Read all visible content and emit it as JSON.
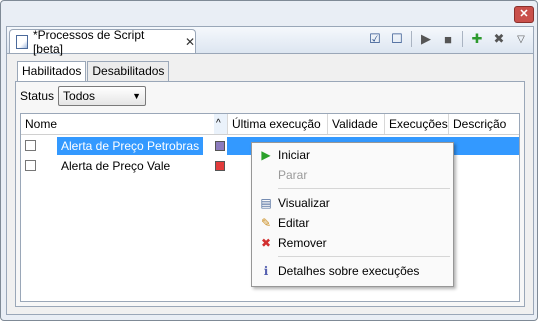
{
  "window": {
    "close_glyph": "✕"
  },
  "editor_tab": {
    "title": "*Processos de Script [beta]",
    "close_glyph": "✕"
  },
  "toolbar": {
    "icons": [
      "checkbox-checked-icon",
      "checkbox-empty-icon",
      "play-icon",
      "stop-icon",
      "add-icon",
      "remove-icon",
      "dropdown-arrow-icon"
    ],
    "glyphs": {
      "check": "☑",
      "uncheck": "☐",
      "play": "▶",
      "stop": "■",
      "add": "✚",
      "remove": "✖",
      "menu": "▽"
    }
  },
  "subtabs": [
    "Habilitados",
    "Desabilitados"
  ],
  "status": {
    "label": "Status",
    "value": "Todos",
    "arrow": "▼"
  },
  "table": {
    "sort_glyph": "^",
    "columns": [
      "Nome",
      "Última execução",
      "Validade",
      "Execuções",
      "Descrição"
    ],
    "rows": [
      {
        "name": "Alerta de Preço Petrobras",
        "color": "#8c7bbd"
      },
      {
        "name": "Alerta de Preço Vale",
        "color": "#e23b3b"
      }
    ]
  },
  "context_menu": {
    "items": [
      {
        "label": "Iniciar",
        "icon": "play-icon",
        "glyph": "▶",
        "enabled": true
      },
      {
        "label": "Parar",
        "icon": "",
        "enabled": false
      },
      {
        "label": "Visualizar",
        "icon": "document-icon",
        "glyph": "▤",
        "enabled": true
      },
      {
        "label": "Editar",
        "icon": "edit-icon",
        "glyph": "✎",
        "enabled": true
      },
      {
        "label": "Remover",
        "icon": "remove-icon",
        "glyph": "✖",
        "enabled": true
      },
      {
        "label": "Detalhes sobre execuções",
        "icon": "info-icon",
        "glyph": "ℹ",
        "enabled": true
      }
    ]
  },
  "colors": {
    "selection": "#3399ff",
    "play_green": "#2aa12a",
    "remove_red": "#d23030",
    "add_green": "#2d9a2d"
  }
}
